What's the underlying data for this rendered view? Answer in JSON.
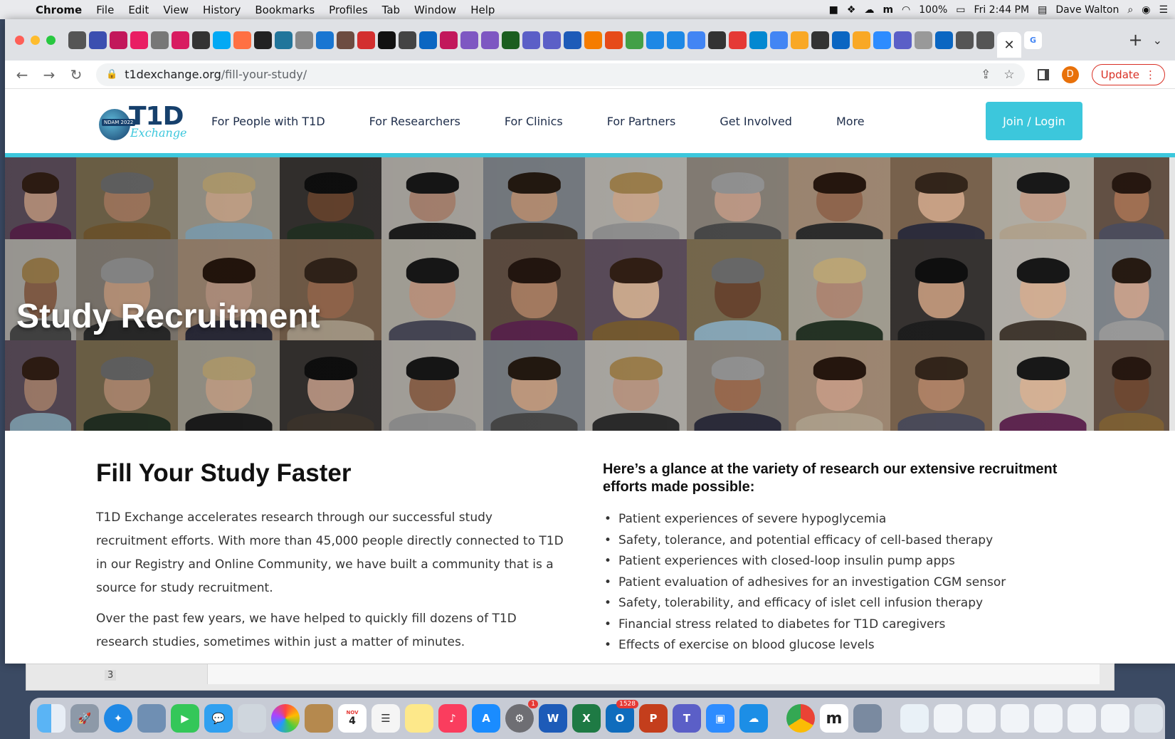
{
  "menubar": {
    "apple": "",
    "items": [
      "Chrome",
      "File",
      "Edit",
      "View",
      "History",
      "Bookmarks",
      "Profiles",
      "Tab",
      "Window",
      "Help"
    ],
    "battery": "100%",
    "clock": "Fri 2:44 PM",
    "user": "Dave Walton"
  },
  "browser": {
    "url_host": "t1dexchange.org",
    "url_path": "/fill-your-study/",
    "update_label": "Update",
    "profile_initial": "D",
    "active_tab_close": "✕",
    "new_tab": "+"
  },
  "site": {
    "logo_text": "T1D",
    "logo_script": "Exchange",
    "logo_badge": "NDAM 2022",
    "nav": [
      "For People with T1D",
      "For Researchers",
      "For Clinics",
      "For Partners",
      "Get Involved",
      "More"
    ],
    "join_label": "Join / Login",
    "accent": "#3cc7dc"
  },
  "hero": {
    "title": "Study Recruitment"
  },
  "content": {
    "heading": "Fill Your Study Faster",
    "para1": "T1D Exchange accelerates research through our successful study recruitment efforts. With more than 45,000 people directly connected to T1D in our Registry and Online Community, we have built a community that is a source for study recruitment.",
    "para2": "Over the past few years, we have helped to quickly fill dozens of T1D research studies, sometimes within just a matter of minutes.",
    "list_heading": "Here’s a glance at the variety of research our extensive recruitment efforts made possible:",
    "list": [
      "Patient experiences of severe hypoglycemia",
      "Safety, tolerance, and potential efficacy of cell-based therapy",
      "Patient experiences with closed-loop insulin pump apps",
      "Patient evaluation of adhesives for an investigation CGM sensor",
      "Safety, tolerability, and efficacy of islet cell infusion therapy",
      "Financial stress related to diabetes for T1D caregivers",
      "Effects of exercise on blood glucose levels"
    ]
  },
  "background_window": {
    "page_number": "3"
  },
  "dock": {
    "calendar_day": "4",
    "calendar_month": "NOV",
    "settings_badge": "1",
    "outlook_badge": "1528"
  }
}
